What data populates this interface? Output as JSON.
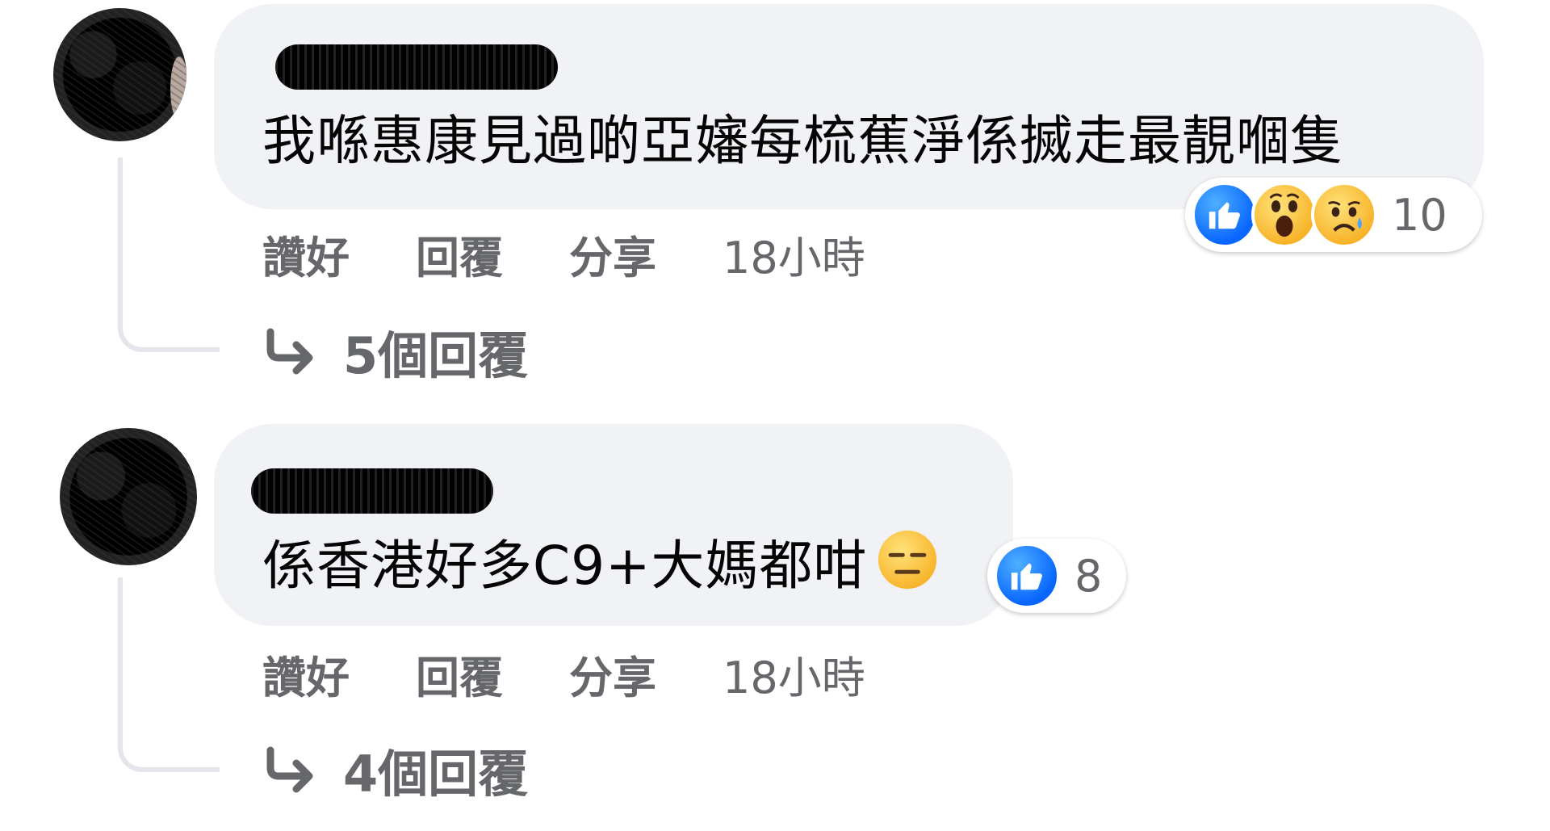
{
  "colors": {
    "bubble_bg": "#f0f2f5",
    "secondary_text": "#65676b",
    "like_blue": "#0866ff",
    "emoji_yellow": "#f7b125"
  },
  "comments": [
    {
      "author": "",
      "text": "我喺惠康見過啲亞嬸每梳蕉淨係搣走最靚嗰隻",
      "reactions": {
        "icons": [
          "like-icon",
          "wow-icon",
          "sad-icon"
        ],
        "count": "10"
      },
      "actions": {
        "like": "讚好",
        "reply": "回覆",
        "share": "分享",
        "time": "18小時"
      },
      "replies_label": "5個回覆"
    },
    {
      "author": "",
      "text": "係香港好多C9+大媽都咁",
      "inline_emoji": "expressionless-face-icon",
      "reactions": {
        "icons": [
          "like-icon"
        ],
        "count": "8"
      },
      "actions": {
        "like": "讚好",
        "reply": "回覆",
        "share": "分享",
        "time": "18小時"
      },
      "replies_label": "4個回覆"
    }
  ]
}
